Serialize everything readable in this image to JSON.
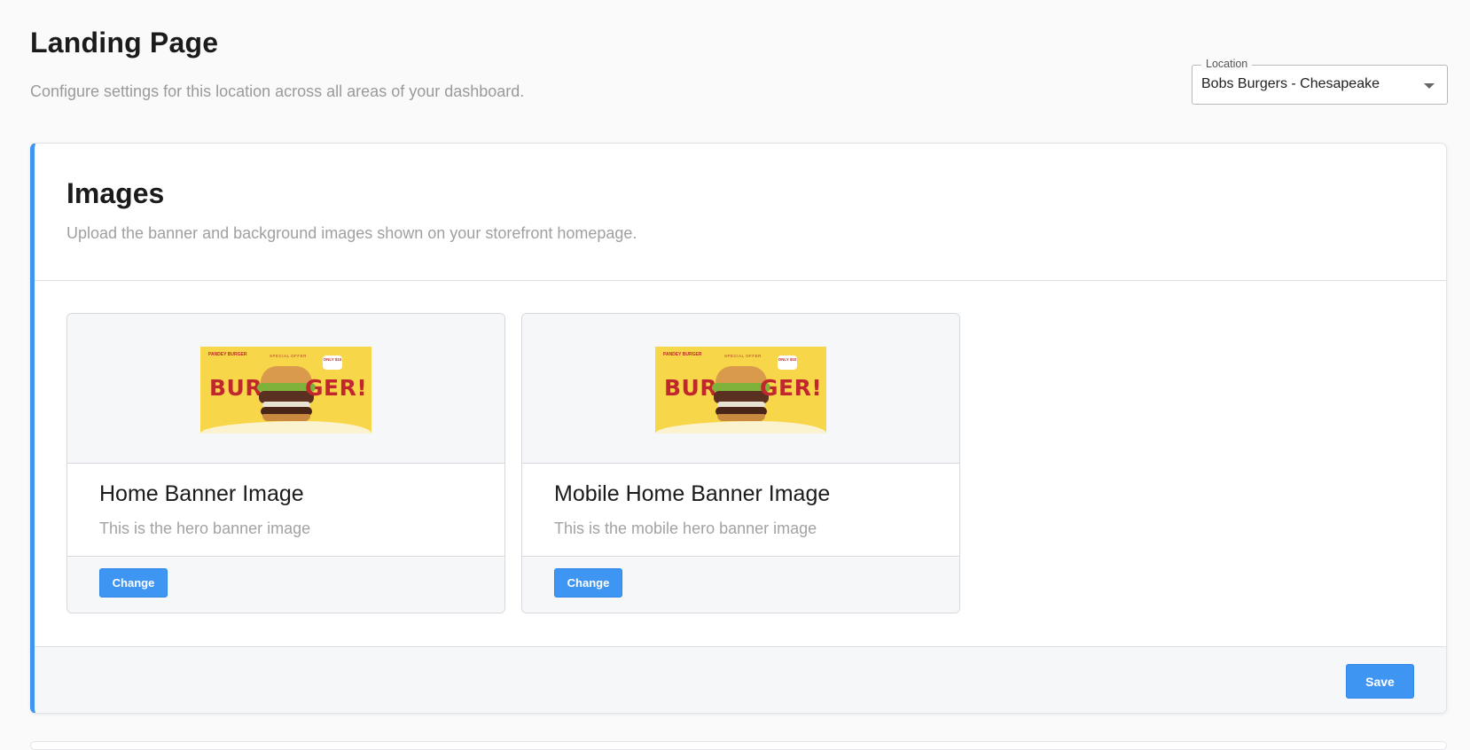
{
  "page": {
    "title": "Landing Page",
    "subtitle": "Configure settings for this location across all areas of your dashboard."
  },
  "location": {
    "label": "Location",
    "value": "Bobs Burgers - Chesapeake"
  },
  "images_panel": {
    "title": "Images",
    "subtitle": "Upload the banner and background images shown on your storefront homepage.",
    "cards": [
      {
        "title": "Home Banner Image",
        "description": "This is the hero banner image",
        "button": "Change"
      },
      {
        "title": "Mobile Home Banner Image",
        "description": "This is the mobile hero banner image",
        "button": "Change"
      }
    ],
    "save_label": "Save"
  },
  "banner_art": {
    "logo": "PANDEY BURGER",
    "offer": "SPECIAL OFFER",
    "price": "ONLY $10",
    "word_left": "BUR",
    "word_right": "GER!"
  },
  "colors": {
    "accent": "#3e95f2",
    "banner_bg": "#f8d64a",
    "banner_text": "#c0282d"
  }
}
